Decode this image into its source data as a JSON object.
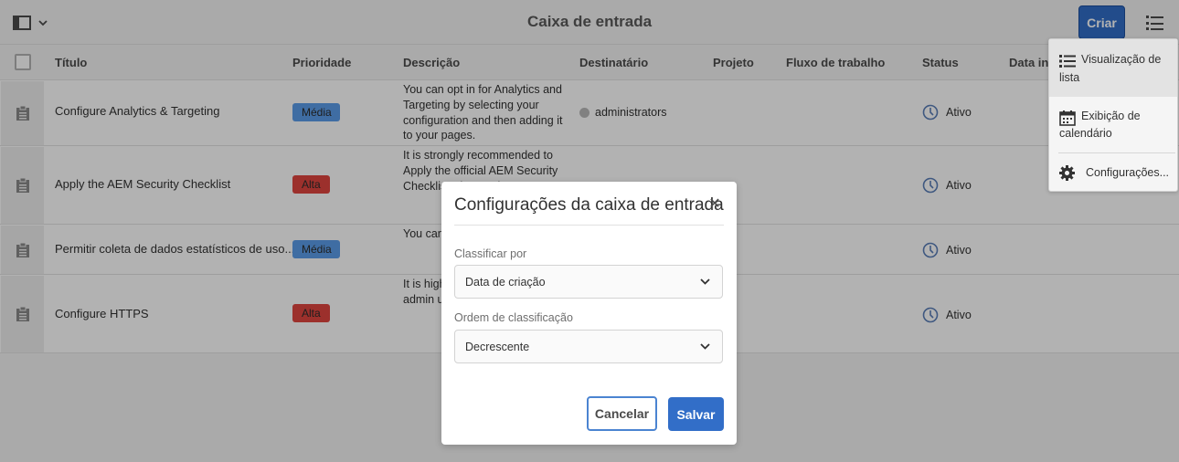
{
  "header": {
    "title": "Caixa de entrada",
    "create_label": "Criar",
    "rail_toggle_icon": "rail-toggle-icon",
    "view_switcher_icon": "list-view-icon"
  },
  "table": {
    "columns": [
      "Título",
      "Prioridade",
      "Descrição",
      "Destinatário",
      "Projeto",
      "Fluxo de trabalho",
      "Status",
      "Data ini"
    ],
    "rows": [
      {
        "title": "Configure Analytics & Targeting",
        "priority": "Média",
        "description": "You can opt in for Analytics and Targeting by selecting your configuration and then adding it to your pages.",
        "recipient": "administrators",
        "status": "Ativo"
      },
      {
        "title": "Apply the AEM Security Checklist",
        "priority": "Alta",
        "description": "It is strongly recommended to Apply the official AEM Security Checklist Please r by open",
        "recipient": "",
        "status": "Ativo"
      },
      {
        "title": "Permitir coleta de dados estatísticos de uso...",
        "priority": "Média",
        "description": "You can usage st enabling",
        "recipient": "",
        "status": "Ativo"
      },
      {
        "title": "Configure HTTPS",
        "priority": "Alta",
        "description": "It is high configur systems admin u Configu",
        "recipient": "",
        "status": "Ativo"
      }
    ]
  },
  "popover": {
    "items": [
      {
        "icon": "list-view-icon",
        "label_line1": "Visualização de",
        "label_line2": "lista"
      },
      {
        "icon": "calendar-icon",
        "label_line1": "Exibição de",
        "label_line2": "calendário"
      },
      {
        "icon": "gear-icon",
        "label_line1": "Configurações..."
      }
    ]
  },
  "dialog": {
    "title": "Configurações da caixa de entrada",
    "close_icon": "close-icon",
    "sort_by_label": "Classificar por",
    "sort_by_value": "Data de criação",
    "sort_order_label": "Ordem de classificação",
    "sort_order_value": "Decrescente",
    "cancel_label": "Cancelar",
    "save_label": "Salvar"
  },
  "colors": {
    "accent": "#326ec8",
    "priority_medium": "#5b9dea",
    "priority_high": "#e0463f"
  }
}
